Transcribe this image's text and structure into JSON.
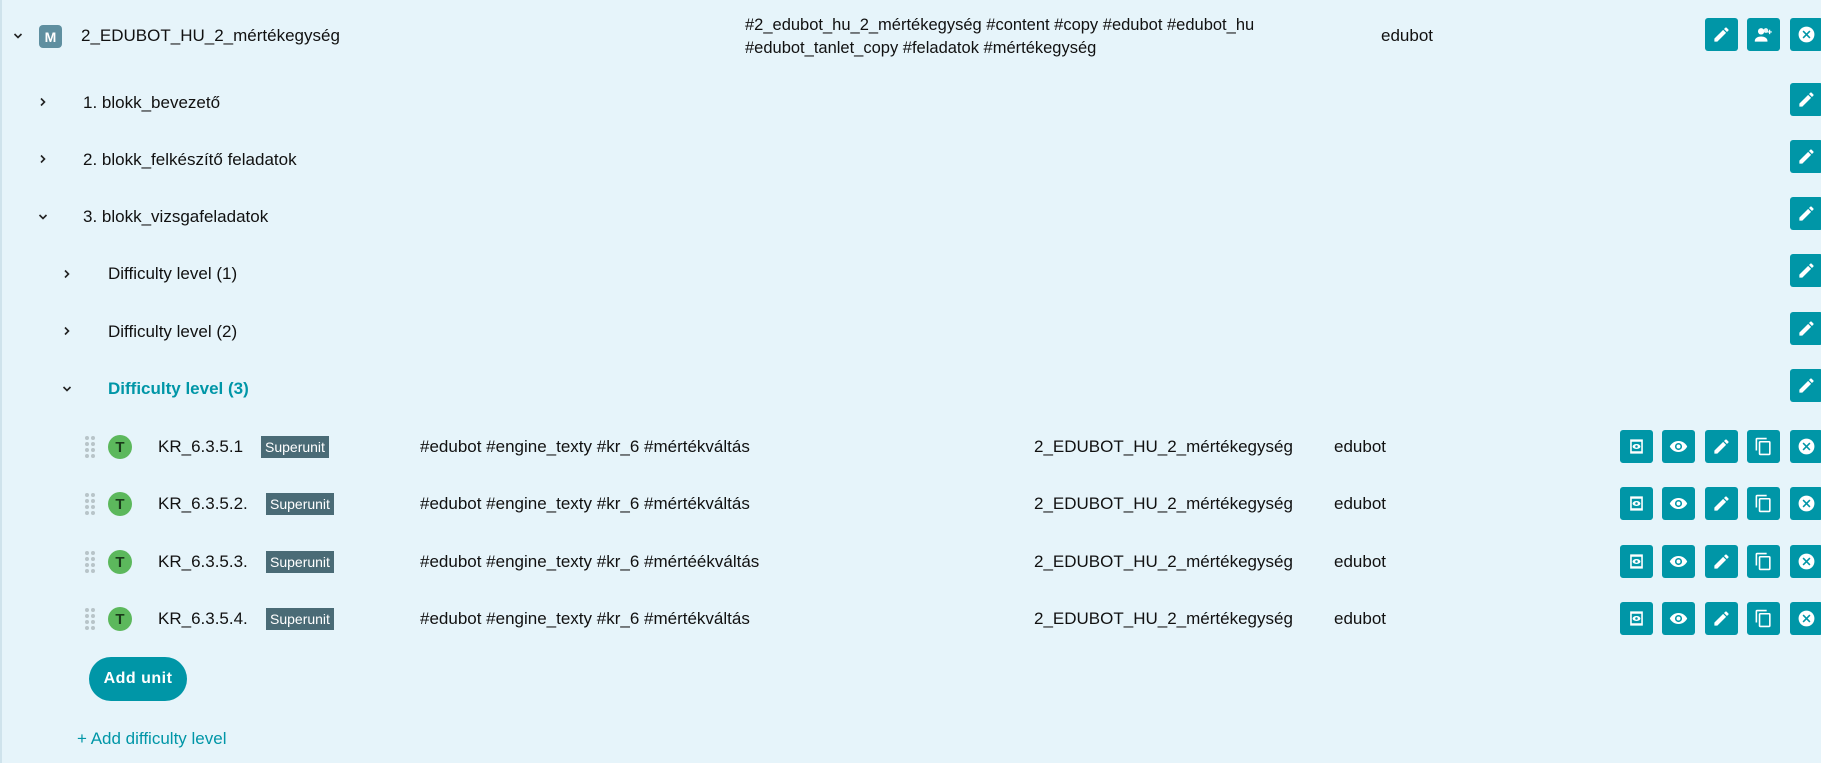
{
  "module": {
    "badge": "M",
    "title": "2_EDUBOT_HU_2_mértékegység",
    "tags_line1": "#2_edubot_hu_2_mértékegység #content #copy #edubot #edubot_hu",
    "tags_line2": "#edubot_tanlet_copy #feladatok #mértékegység",
    "owner": "edubot",
    "expanded": true
  },
  "blocks": [
    {
      "label": "1. blokk_bevezető",
      "expanded": false
    },
    {
      "label": "2. blokk_felkészítő feladatok",
      "expanded": false
    },
    {
      "label": "3. blokk_vizsgafeladatok",
      "expanded": true
    }
  ],
  "difficulty_levels": [
    {
      "label": "Difficulty level (1)",
      "expanded": false,
      "active": false
    },
    {
      "label": "Difficulty level (2)",
      "expanded": false,
      "active": false
    },
    {
      "label": "Difficulty level (3)",
      "expanded": true,
      "active": true
    }
  ],
  "units": [
    {
      "badge": "T",
      "code": "KR_6.3.5.1",
      "type": "Superunit",
      "tags": "#edubot #engine_texty #kr_6 #mértékváltás",
      "module": "2_EDUBOT_HU_2_mértékegység",
      "owner": "edubot"
    },
    {
      "badge": "T",
      "code": "KR_6.3.5.2.",
      "type": "Superunit",
      "tags": "#edubot #engine_texty #kr_6 #mértékváltás",
      "module": "2_EDUBOT_HU_2_mértékegység",
      "owner": "edubot"
    },
    {
      "badge": "T",
      "code": "KR_6.3.5.3.",
      "type": "Superunit",
      "tags": "#edubot #engine_texty #kr_6 #mértéékváltás",
      "module": "2_EDUBOT_HU_2_mértékegység",
      "owner": "edubot"
    },
    {
      "badge": "T",
      "code": "KR_6.3.5.4.",
      "type": "Superunit",
      "tags": "#edubot #engine_texty #kr_6 #mértékváltás",
      "module": "2_EDUBOT_HU_2_mértékegység",
      "owner": "edubot"
    }
  ],
  "actions": {
    "add_unit": "Add unit",
    "add_difficulty_level": "+ Add difficulty level"
  },
  "colors": {
    "accent": "#0096a7",
    "background": "#e6f4fa",
    "superunit_badge": "#4a6b76",
    "type_badge": "#5cb85c",
    "module_badge": "#5f8fa0"
  }
}
